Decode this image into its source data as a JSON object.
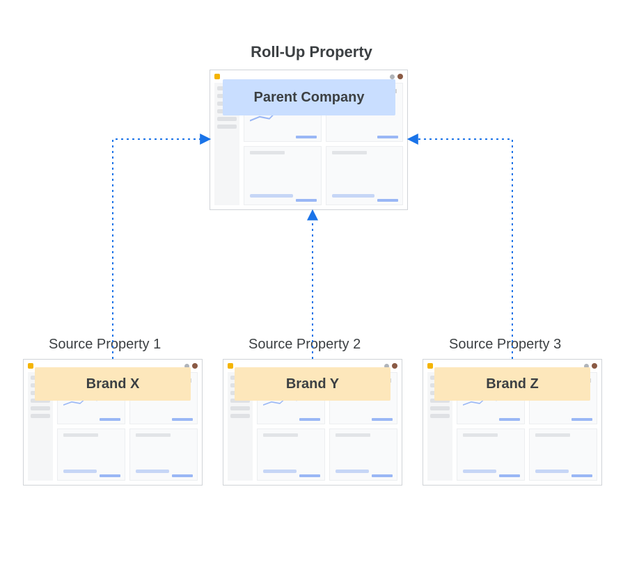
{
  "diagram_title": "Roll-Up Property",
  "parent_label": "Parent Company",
  "sources": [
    {
      "title": "Source Property 1",
      "brand": "Brand  X"
    },
    {
      "title": "Source Property 2",
      "brand": "Brand Y"
    },
    {
      "title": "Source Property 3",
      "brand": "Brand Z"
    }
  ],
  "colors": {
    "arrow": "#1a73e8",
    "parent_banner": "#c9deff",
    "source_banner": "#fde7bb"
  }
}
